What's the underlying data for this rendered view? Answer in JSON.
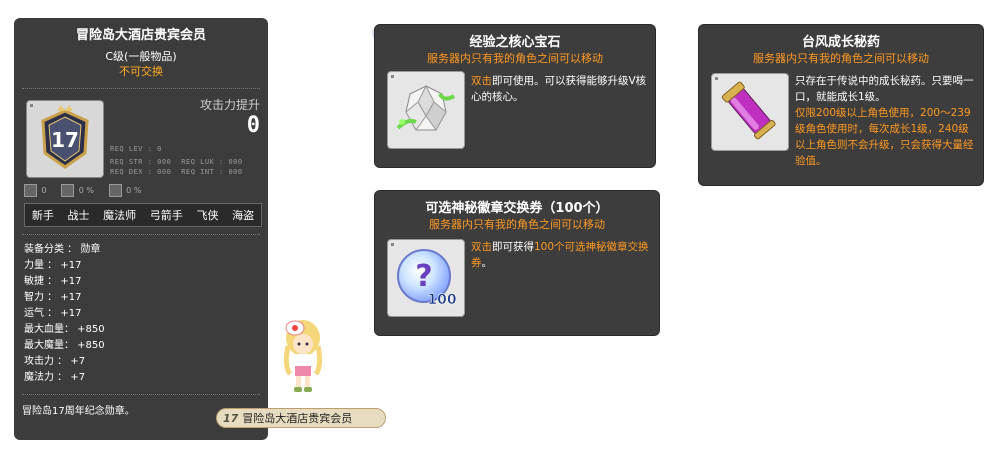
{
  "left_tooltip": {
    "title": "冒险岛大酒店贵宾会员",
    "grade": "C级(一般物品)",
    "tradable": "不可交换",
    "attack_increase_label": "攻击力提升",
    "attack_increase_value": "0",
    "medal_number": "17",
    "requirements": {
      "lev": "REQ LEV :     0",
      "str": "REQ STR : 000",
      "dex": "REQ DEX : 000",
      "luk": "REQ LUK : 000",
      "int": "REQ INT : 000"
    },
    "small_stats": [
      "0",
      "0 %",
      "0 %"
    ],
    "jobs": [
      "新手",
      "战士",
      "魔法师",
      "弓箭手",
      "飞侠",
      "海盗"
    ],
    "stats": [
      "装备分类 ： 勋章",
      "力量 ： +17",
      "敏捷 ： +17",
      "智力 ： +17",
      "运气 ： +17",
      "最大血量： +850",
      "最大魔量： +850",
      "攻击力 ： +7",
      "魔法力 ： +7"
    ],
    "description": "冒险岛17周年纪念勋章。"
  },
  "medal_badge": {
    "number": "17",
    "label": "冒险岛大酒店贵宾会员"
  },
  "core_gem": {
    "title": "经验之核心宝石",
    "subtitle": "服务器内只有我的角色之间可以移动",
    "desc_prefix": "双击",
    "desc_rest": "即可使用。可以获得能够升级V核心的核心。"
  },
  "typhoon_potion": {
    "title": "台风成长秘药",
    "subtitle": "服务器内只有我的角色之间可以移动",
    "desc_white": "只存在于传说中的成长秘药。只要喝一口，就能成长1级。",
    "desc_orange": "仅限200级以上角色使用，200～239级角色使用时，每次成长1级，240级以上角色则不会升级，只会获得大量经验值。"
  },
  "emblem_voucher": {
    "title": "可选神秘徽章交换券（100个）",
    "subtitle": "服务器内只有我的角色之间可以移动",
    "desc_prefix": "双击",
    "desc_mid": "即可获得",
    "desc_orange": "100个可选神秘徽章交换券",
    "desc_end": "。",
    "icon_number": "100"
  }
}
